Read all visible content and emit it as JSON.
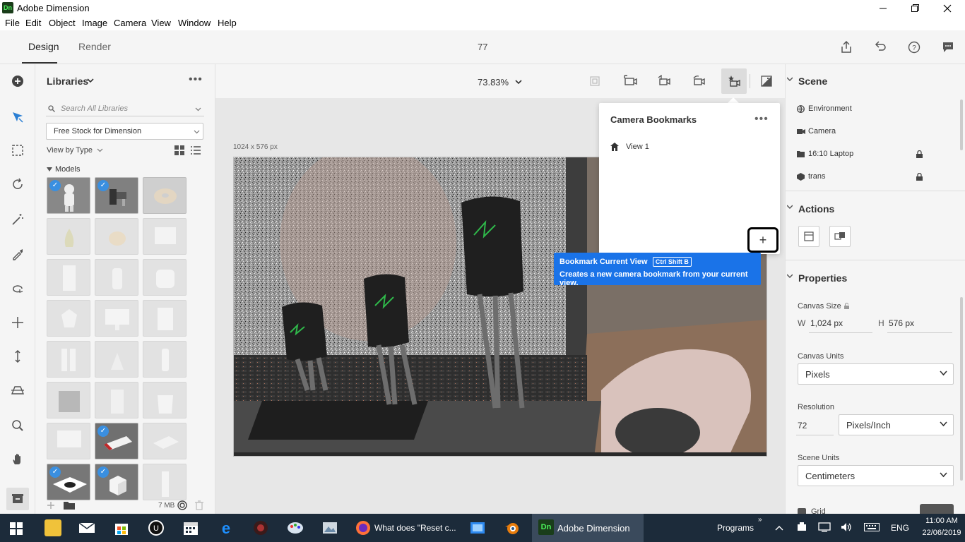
{
  "window": {
    "badge": "Dn",
    "title": "Adobe Dimension"
  },
  "menu": [
    "File",
    "Edit",
    "Object",
    "Image",
    "Camera",
    "View",
    "Window",
    "Help"
  ],
  "modes": {
    "design": "Design",
    "render": "Render"
  },
  "document": {
    "name": "77"
  },
  "libraries": {
    "title": "Libraries",
    "search_placeholder": "Search All Libraries",
    "selected_library": "Free Stock for Dimension",
    "view_by": "View by Type",
    "section": "Models",
    "footer_size": "7 MB"
  },
  "canvas": {
    "zoom": "73.83%",
    "dimensions": "1024 x 576 px"
  },
  "camera_bookmarks": {
    "title": "Camera Bookmarks",
    "more": "•••",
    "items": [
      "View 1"
    ],
    "add": "+"
  },
  "tooltip": {
    "title": "Bookmark Current View",
    "shortcut": "Ctrl Shift B",
    "description": "Creates a new camera bookmark from your current view."
  },
  "scene": {
    "title": "Scene",
    "items": [
      {
        "label": "Environment"
      },
      {
        "label": "Camera"
      },
      {
        "label": "16:10 Laptop"
      },
      {
        "label": "trans"
      }
    ]
  },
  "actions": {
    "title": "Actions"
  },
  "properties": {
    "title": "Properties",
    "canvas_size_label": "Canvas Size",
    "w_label": "W",
    "w_value": "1,024 px",
    "h_label": "H",
    "h_value": "576 px",
    "canvas_units_label": "Canvas Units",
    "canvas_units": "Pixels",
    "resolution_label": "Resolution",
    "resolution_value": "72",
    "resolution_unit": "Pixels/Inch",
    "scene_units_label": "Scene Units",
    "scene_units": "Centimeters",
    "grid_label": "Grid"
  },
  "taskbar": {
    "chrome_title": "What does \"Reset c...",
    "dn_badge": "Dn",
    "dn_title": "Adobe Dimension",
    "programs": "Programs",
    "lang": "ENG",
    "time": "11:00 AM",
    "date": "22/06/2019"
  }
}
